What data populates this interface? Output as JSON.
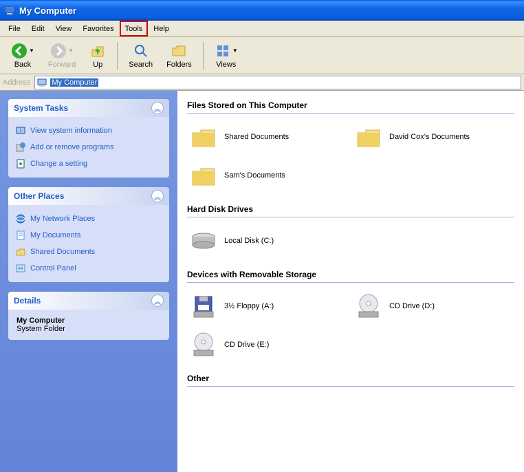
{
  "window": {
    "title": "My Computer"
  },
  "menu": {
    "file": "File",
    "edit": "Edit",
    "view": "View",
    "favorites": "Favorites",
    "tools": "Tools",
    "help": "Help",
    "highlighted": "tools"
  },
  "toolbar": {
    "back": "Back",
    "forward": "Forward",
    "up": "Up",
    "search": "Search",
    "folders": "Folders",
    "views": "Views"
  },
  "address": {
    "label": "Address",
    "value": "My Computer"
  },
  "panels": {
    "system_tasks": {
      "title": "System Tasks",
      "links": [
        {
          "label": "View system information",
          "icon": "info-icon"
        },
        {
          "label": "Add or remove programs",
          "icon": "programs-icon"
        },
        {
          "label": "Change a setting",
          "icon": "settings-icon"
        }
      ]
    },
    "other_places": {
      "title": "Other Places",
      "links": [
        {
          "label": "My Network Places",
          "icon": "network-icon"
        },
        {
          "label": "My Documents",
          "icon": "documents-icon"
        },
        {
          "label": "Shared Documents",
          "icon": "shared-folder-icon"
        },
        {
          "label": "Control Panel",
          "icon": "control-panel-icon"
        }
      ]
    },
    "details": {
      "title": "Details",
      "name": "My Computer",
      "type": "System Folder"
    }
  },
  "sections": {
    "files_stored": {
      "title": "Files Stored on This Computer",
      "items": [
        {
          "label": "Shared Documents",
          "icon": "folder"
        },
        {
          "label": "David Cox's Documents",
          "icon": "folder"
        },
        {
          "label": "Sam's Documents",
          "icon": "folder"
        }
      ]
    },
    "hard_disks": {
      "title": "Hard Disk Drives",
      "items": [
        {
          "label": "Local Disk (C:)",
          "icon": "hdd"
        }
      ]
    },
    "removable": {
      "title": "Devices with Removable Storage",
      "items": [
        {
          "label": "3½ Floppy (A:)",
          "icon": "floppy"
        },
        {
          "label": "CD Drive (D:)",
          "icon": "cd"
        },
        {
          "label": "CD Drive (E:)",
          "icon": "cd"
        }
      ]
    },
    "other": {
      "title": "Other",
      "items": []
    }
  }
}
